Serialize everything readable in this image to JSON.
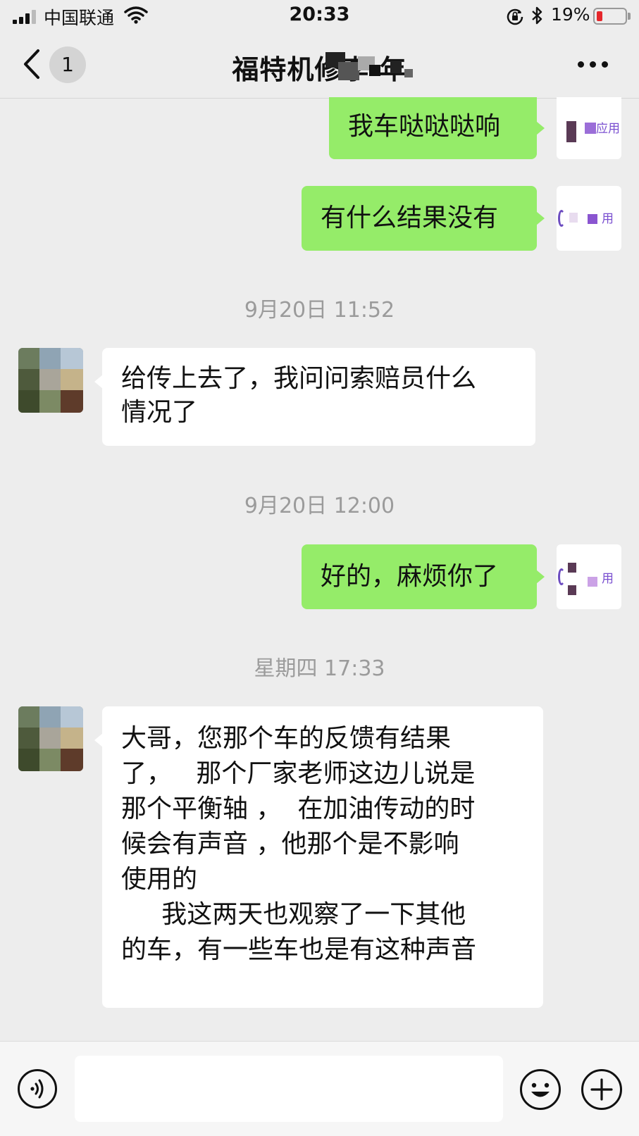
{
  "status_bar": {
    "carrier": "中国联通",
    "time": "20:33",
    "battery_percent": "19%",
    "battery_level": 0.19,
    "battery_color": "#e5272b"
  },
  "nav": {
    "back_icon": "chevron-left-icon",
    "unread_count": "1",
    "title": "福特机修李 年",
    "more_icon": "more-dots-icon"
  },
  "messages": [
    {
      "side": "self",
      "text": "我车哒哒哒响"
    },
    {
      "side": "self",
      "text": "有什么结果没有"
    },
    {
      "side": "timestamp",
      "text": "9月20日 11:52"
    },
    {
      "side": "other",
      "lines": [
        "给传上去了，我问问索赔员什么",
        "情况了"
      ]
    },
    {
      "side": "timestamp",
      "text": "9月20日 12:00"
    },
    {
      "side": "self",
      "text": "好的，麻烦你了"
    },
    {
      "side": "timestamp",
      "text": "星期四 17:33"
    },
    {
      "side": "other",
      "lines": [
        "大哥，您那个车的反馈有结果",
        "了，   那个厂家老师这边儿说是",
        "那个平衡轴 ，  在加油传动的时",
        "候会有声音 ，他那个是不影响",
        "使用的",
        "     我这两天也观察了一下其他",
        "的车，有一些车也是有这种声音"
      ]
    }
  ],
  "self_avatar_fragments": [
    "应用",
    "用",
    "用"
  ],
  "colors": {
    "outgoing_bubble": "#95ec69",
    "incoming_bubble": "#ffffff",
    "background": "#ededed"
  },
  "input_bar": {
    "voice_icon": "voice-icon",
    "input_value": "",
    "emoji_icon": "emoji-icon",
    "plus_icon": "plus-circle-icon"
  }
}
